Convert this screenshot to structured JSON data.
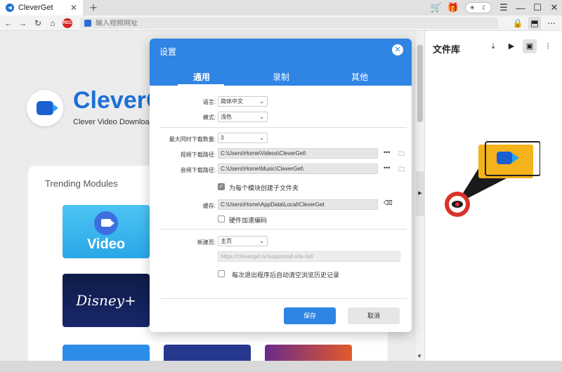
{
  "browser": {
    "tab_title": "CleverGet",
    "tab_close": "✕",
    "new_tab": "+",
    "url_placeholder": "输入视频网址",
    "rec_label": "REC"
  },
  "page": {
    "brand": "CleverG",
    "slogan": "Clever Video Downloa",
    "trending_title": "Trending Modules",
    "video_card_label": "Video",
    "disney_card_label": "Disney+",
    "more": "•••"
  },
  "library": {
    "title": "文件库"
  },
  "dialog": {
    "title": "设置",
    "tabs": [
      "通用",
      "录制",
      "其他"
    ],
    "language_label": "语言:",
    "language_value": "简体中文",
    "mode_label": "模式:",
    "mode_value": "浅色",
    "max_downloads_label": "最大同时下载数量:",
    "max_downloads_value": "3",
    "video_path_label": "视频下载路径:",
    "video_path_value": "C:\\Users\\Home\\Videos\\CleverGet\\",
    "audio_path_label": "音频下载路径:",
    "audio_path_value": "C:\\Users\\Home\\Music\\CleverGet\\",
    "subfolder_label": "为每个模块创建子文件夹",
    "cache_label": "缓存:",
    "cache_value": "C:\\Users\\Home\\AppData\\Local\\CleverGet",
    "hw_accel_label": "硬件加速编码",
    "homepage_label": "新建页:",
    "homepage_value": "主页",
    "homepage_url": "https://cleverget.tv/supported-site-list/",
    "clear_history_label": "每次退出程序后自动清空浏览历史记录",
    "more_dots": "•••",
    "save": "保存",
    "cancel": "取消"
  },
  "colors": {
    "accent": "#2f84e4",
    "brand": "#1c6fd6",
    "rec": "#d52222"
  }
}
